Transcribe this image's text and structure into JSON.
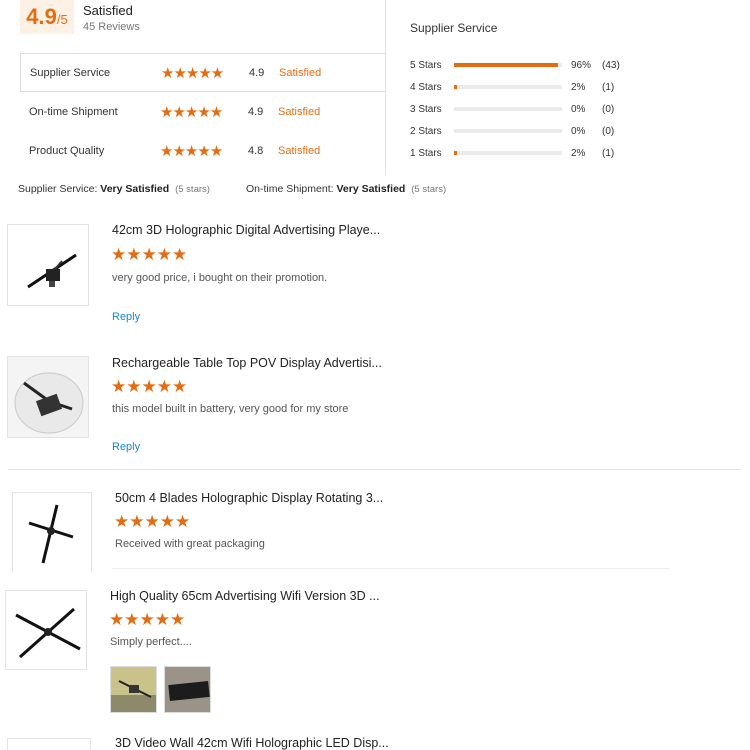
{
  "summary": {
    "score": "4.9",
    "score_out_of": "/5",
    "status": "Satisfied",
    "reviews": "45 Reviews"
  },
  "metrics": [
    {
      "label": "Supplier Service",
      "stars": "★★★★★",
      "score": "4.9",
      "status": "Satisfied"
    },
    {
      "label": "On-time Shipment",
      "stars": "★★★★★",
      "score": "4.9",
      "status": "Satisfied"
    },
    {
      "label": "Product Quality",
      "stars": "★★★★★",
      "score": "4.8",
      "status": "Satisfied"
    }
  ],
  "histogram": {
    "title": "Supplier Service",
    "rows": [
      {
        "label": "5 Stars",
        "fraction": 0.96,
        "pct": "96%",
        "count": "(43)"
      },
      {
        "label": "4 Stars",
        "fraction": 0.02,
        "pct": "2%",
        "count": "(1)"
      },
      {
        "label": "3 Stars",
        "fraction": 0.0,
        "pct": "0%",
        "count": "(0)"
      },
      {
        "label": "2 Stars",
        "fraction": 0.0,
        "pct": "0%",
        "count": "(0)"
      },
      {
        "label": "1 Stars",
        "fraction": 0.02,
        "pct": "2%",
        "count": "(1)"
      }
    ]
  },
  "summary_lines": [
    {
      "label": "Supplier Service:",
      "value": "Very Satisfied",
      "note": "(5 stars)"
    },
    {
      "label": "On-time Shipment:",
      "value": "Very Satisfied",
      "note": "(5 stars)"
    }
  ],
  "reviews": [
    {
      "title": "42cm 3D Holographic Digital Advertising Playe...",
      "stars": "★★★★★",
      "text": "very good price, i bought on their promotion.",
      "reply": "Reply"
    },
    {
      "title": "Rechargeable Table Top POV Display Advertisi...",
      "stars": "★★★★★",
      "text": "this model built in battery, very good for my store",
      "reply": "Reply"
    },
    {
      "title": "50cm 4 Blades Holographic Display Rotating 3...",
      "stars": "★★★★★",
      "text": "Received with great packaging"
    },
    {
      "title": "High Quality 65cm Advertising Wifi Version 3D ...",
      "stars": "★★★★★",
      "text": "Simply perfect...."
    },
    {
      "title": "3D Video Wall 42cm Wifi Holographic LED Disp..."
    }
  ],
  "colors": {
    "accent": "#e66c12",
    "link": "#1a88c9",
    "badge_bg": "#fdf1e5"
  }
}
